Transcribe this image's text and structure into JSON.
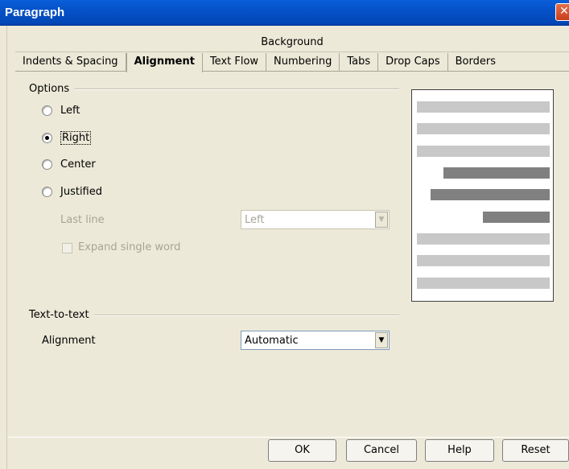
{
  "window": {
    "title": "Paragraph",
    "close_glyph": "✕"
  },
  "tabs": {
    "row_back": [
      "Background"
    ],
    "row_front": [
      "Indents & Spacing",
      "Alignment",
      "Text Flow",
      "Numbering",
      "Tabs",
      "Drop Caps",
      "Borders"
    ],
    "active": "Alignment"
  },
  "options": {
    "group_label": "Options",
    "radios": [
      {
        "label": "Left",
        "accel": "L",
        "checked": false
      },
      {
        "label": "Right",
        "accel": "R",
        "checked": true
      },
      {
        "label": "Center",
        "accel": "C",
        "checked": false
      },
      {
        "label": "Justified",
        "accel": "J",
        "checked": false
      }
    ],
    "last_line_label": "Last line",
    "last_line_value": "Left",
    "expand_label": "Expand single word"
  },
  "text_to_text": {
    "group_label": "Text-to-text",
    "alignment_label": "Alignment",
    "alignment_value": "Automatic"
  },
  "buttons": {
    "ok": "OK",
    "cancel": "Cancel",
    "help": "Help",
    "reset": "Reset"
  },
  "colors": {
    "title_bar": "#0551c8",
    "dialog_bg": "#ece9d8",
    "preview_light": "#c8c8c8",
    "preview_dark": "#808080"
  }
}
